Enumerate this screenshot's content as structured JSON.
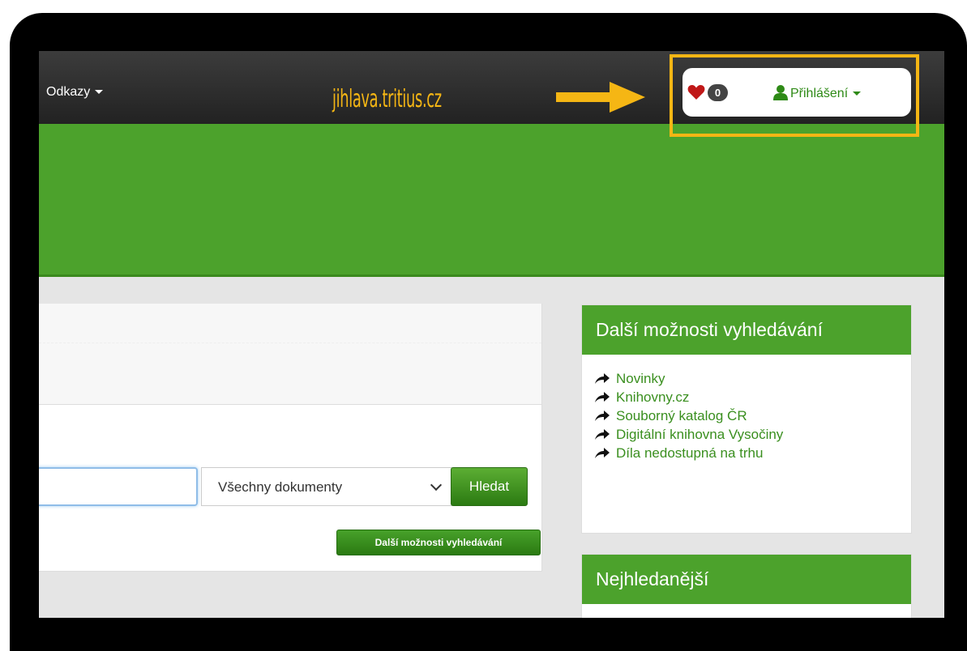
{
  "annotation": {
    "domain_label": "jihlava.tritius.cz",
    "highlight_color": "#f5b614"
  },
  "navbar": {
    "links_label": "Odkazy",
    "favorites_count": "0",
    "login_label": "Přihlášení"
  },
  "search": {
    "input_value": "",
    "doc_type_selected": "Všechny dokumenty",
    "search_button": "Hledat",
    "more_options_button": "Další možnosti vyhledávání"
  },
  "sidebar": {
    "more_search_title": "Další možnosti vyhledávání",
    "links": [
      {
        "label": "Novinky"
      },
      {
        "label": "Knihovny.cz"
      },
      {
        "label": "Souborný katalog ČR"
      },
      {
        "label": "Digitální knihovna Vysočiny"
      },
      {
        "label": "Díla nedostupná na trhu"
      }
    ],
    "most_searched_title": "Nejhledanější"
  },
  "colors": {
    "brand_green": "#4ca22c",
    "link_green": "#3a8f1f",
    "navbar": "#2b2b2b"
  }
}
